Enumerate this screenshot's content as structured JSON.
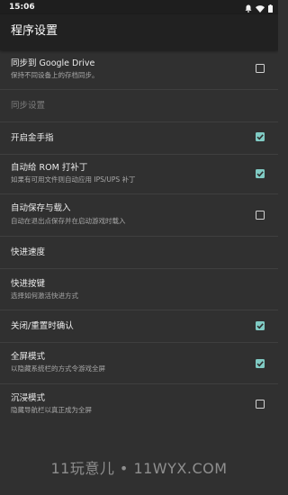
{
  "status_bar": {
    "time": "15:06",
    "icons": [
      "notification-icon",
      "wifi-icon",
      "battery-icon"
    ]
  },
  "app_bar": {
    "title": "程序设置"
  },
  "settings": [
    {
      "label": "同步到 Google Drive",
      "summary": "保持不同设备上的存档同步。",
      "checkbox": true,
      "checked": false,
      "enabled": true
    },
    {
      "label": "同步设置",
      "summary": "",
      "checkbox": false,
      "checked": false,
      "enabled": false
    },
    {
      "label": "开启金手指",
      "summary": "",
      "checkbox": true,
      "checked": true,
      "enabled": true
    },
    {
      "label": "自动给 ROM 打补丁",
      "summary": "如果有可用文件则自动应用 IPS/UPS 补丁",
      "checkbox": true,
      "checked": true,
      "enabled": true
    },
    {
      "label": "自动保存与载入",
      "summary": "自动在退出点保存并在启动游戏时载入",
      "checkbox": true,
      "checked": false,
      "enabled": true
    },
    {
      "label": "快进速度",
      "summary": "",
      "checkbox": false,
      "checked": false,
      "enabled": true
    },
    {
      "label": "快进按键",
      "summary": "选择如何激活快进方式",
      "checkbox": false,
      "checked": false,
      "enabled": true
    },
    {
      "label": "关闭/重置时确认",
      "summary": "",
      "checkbox": true,
      "checked": true,
      "enabled": true
    },
    {
      "label": "全屏模式",
      "summary": "以隐藏系统栏的方式令游戏全屏",
      "checkbox": true,
      "checked": true,
      "enabled": true
    },
    {
      "label": "沉浸模式",
      "summary": "隐藏导航栏以真正成为全屏",
      "checkbox": true,
      "checked": false,
      "enabled": true
    }
  ],
  "watermark": "11玩意儿 • 11WYX.COM",
  "colors": {
    "background": "#303030",
    "app_bar": "#212121",
    "status_bar": "#1e1e1e",
    "accent": "#80cbc4",
    "divider": "#3f3f3f"
  }
}
